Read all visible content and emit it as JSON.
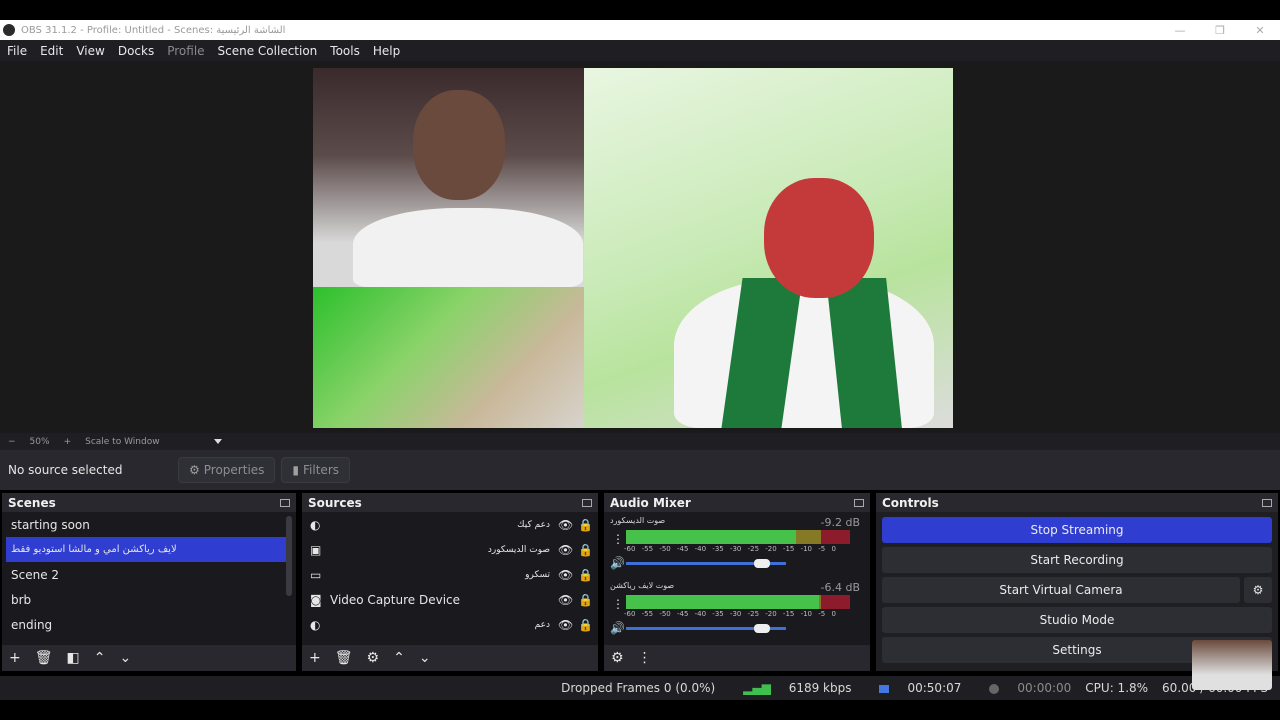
{
  "window": {
    "title": "OBS 31.1.2 - Profile: Untitled - Scenes: الشاشة الرئيسية",
    "controls": [
      "—",
      "❐",
      "✕"
    ]
  },
  "menu": [
    "File",
    "Edit",
    "View",
    "Docks",
    "Profile",
    "Scene Collection",
    "Tools",
    "Help"
  ],
  "zoom": {
    "minus": "−",
    "value": "50%",
    "plus": "+",
    "mode": "Scale to Window"
  },
  "context": {
    "no_source": "No source selected",
    "properties": "Properties",
    "filters": "Filters"
  },
  "scenes": {
    "title": "Scenes",
    "items": [
      "starting soon",
      "لايف رياكشن امي و مالشا  استوديو فقط",
      "Scene 2",
      "brb",
      "ending"
    ],
    "selected_index": 1
  },
  "sources": {
    "title": "Sources",
    "items": [
      {
        "name": "دعم كيك",
        "icon": "browser-icon"
      },
      {
        "name": "صوت الديسكورد",
        "icon": "audio-output-icon"
      },
      {
        "name": "تسكرو",
        "icon": "display-capture-icon"
      },
      {
        "name": "Video Capture Device",
        "icon": "camera-icon"
      },
      {
        "name": "دعم",
        "icon": "browser-icon"
      }
    ]
  },
  "mixer": {
    "title": "Audio Mixer",
    "channels": [
      {
        "name": "صوت الديسكورد",
        "db": "-9.2 dB",
        "level": 0.76
      },
      {
        "name": "صوت لايف رياكشن",
        "db": "-6.4 dB",
        "level": 0.86
      }
    ],
    "ticks": "-60 -55 -50 -45 -40 -35 -30 -25 -20 -15 -10 -5 0"
  },
  "controls": {
    "title": "Controls",
    "stop_streaming": "Stop Streaming",
    "start_recording": "Start Recording",
    "start_virtual_camera": "Start Virtual Camera",
    "studio_mode": "Studio Mode",
    "settings": "Settings"
  },
  "status": {
    "dropped": "Dropped Frames 0 (0.0%)",
    "bitrate": "6189 kbps",
    "stream_time": "00:50:07",
    "rec_time": "00:00:00",
    "cpu": "CPU: 1.8%",
    "fps": "60.00 / 60.00 FPS"
  },
  "colors": {
    "accent": "#2f3dd1",
    "meter_green": "#46c24a",
    "meter_yellow": "#857925",
    "meter_red": "#8c1c2c"
  }
}
